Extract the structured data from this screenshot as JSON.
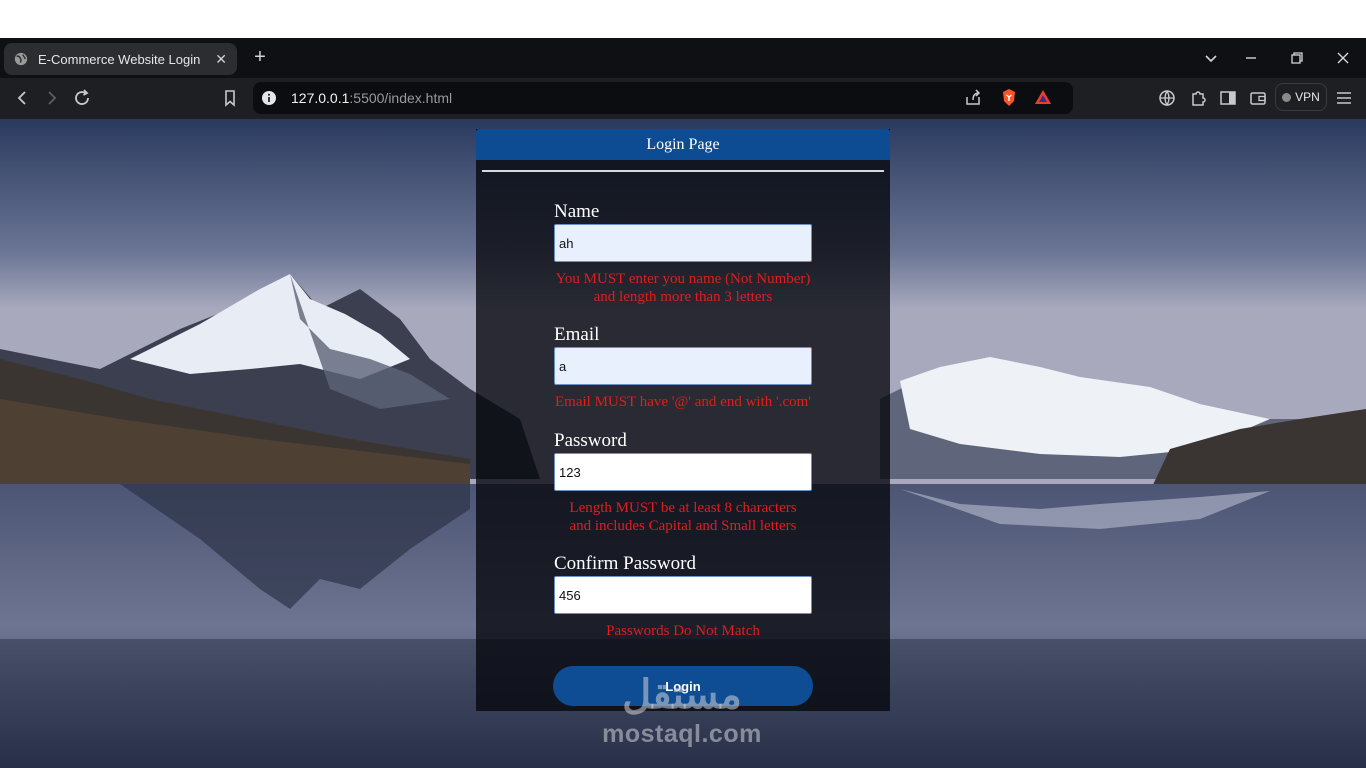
{
  "browser": {
    "tab": {
      "title": "E-Commerce Website Login"
    },
    "address": {
      "host": "127.0.0.1",
      "rest": ":5500/index.html"
    },
    "vpn_label": "VPN"
  },
  "page": {
    "header": "Login Page",
    "fields": [
      {
        "label": "Name",
        "value": "ah",
        "error": [
          "You MUST enter you name (Not Number)",
          "and length more than 3 letters"
        ]
      },
      {
        "label": "Email",
        "value": "a",
        "error": [
          "Email MUST have '@' and end with '.com'"
        ]
      },
      {
        "label": "Password",
        "value": "123",
        "error": [
          "Length MUST be at least 8 characters",
          "and includes Capital and Small letters"
        ]
      },
      {
        "label": "Confirm Password",
        "value": "456",
        "error": [
          "Passwords Do Not Match"
        ]
      }
    ],
    "login_button": "Login"
  },
  "watermark": {
    "logo": "مستقل",
    "domain": "mostaql.com"
  },
  "colors": {
    "header": "#0d4c93",
    "error": "#e41c1c",
    "button": "#0e4c94"
  }
}
